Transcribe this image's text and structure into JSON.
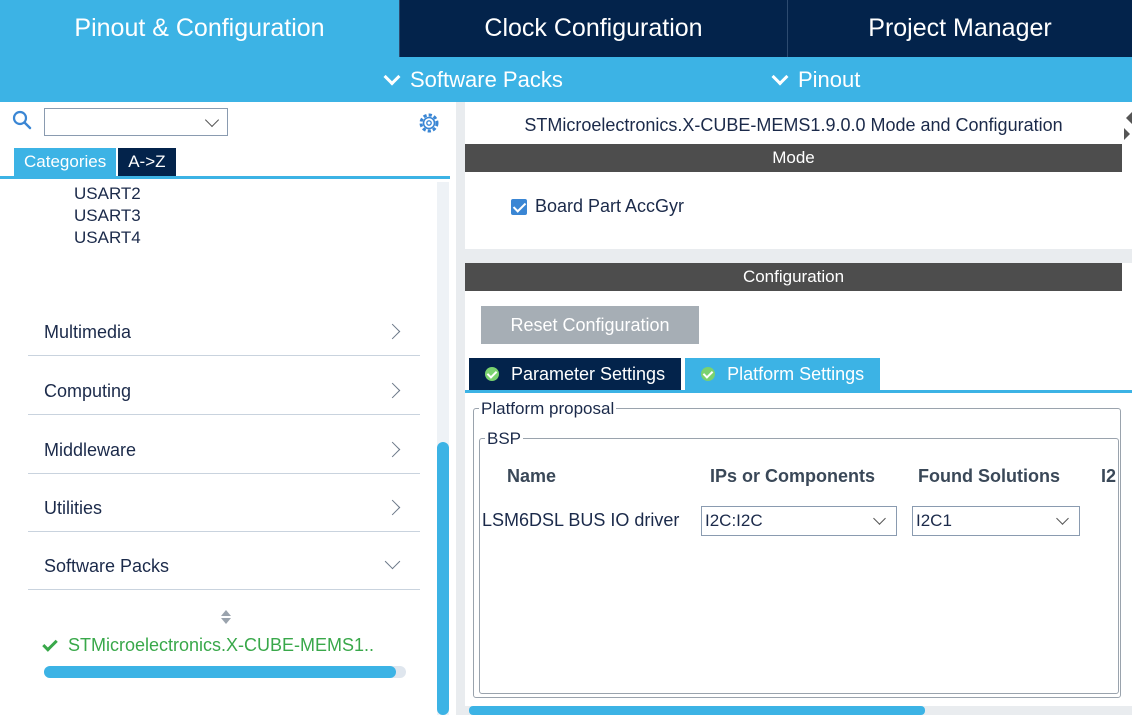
{
  "top_tabs": [
    {
      "label": "Pinout & Configuration",
      "active": true
    },
    {
      "label": "Clock Configuration",
      "active": false
    },
    {
      "label": "Project Manager",
      "active": false
    }
  ],
  "sub_bar": {
    "software_packs": "Software Packs",
    "pinout": "Pinout"
  },
  "left": {
    "search": {
      "value": "",
      "placeholder": ""
    },
    "tabs": {
      "categories": "Categories",
      "a_to_z": "A->Z"
    },
    "usart_items": [
      "USART2",
      "USART3",
      "USART4"
    ],
    "categories": [
      {
        "label": "Multimedia",
        "expanded": false
      },
      {
        "label": "Computing",
        "expanded": false
      },
      {
        "label": "Middleware",
        "expanded": false
      },
      {
        "label": "Utilities",
        "expanded": false
      },
      {
        "label": "Software Packs",
        "expanded": true
      }
    ],
    "pack_item": "STMicroelectronics.X-CUBE-MEMS1..",
    "pack_scroll_progress": 0.97
  },
  "right": {
    "title": "STMicroelectronics.X-CUBE-MEMS1.9.0.0 Mode and Configuration",
    "mode_header": "Mode",
    "board_part_checkbox": {
      "label": "Board Part AccGyr",
      "checked": true
    },
    "config_header": "Configuration",
    "reset_button": "Reset Configuration",
    "tabs": {
      "parameter": "Parameter Settings",
      "platform": "Platform Settings",
      "active": "platform"
    },
    "platform_proposal_legend": "Platform proposal",
    "bsp_legend": "BSP",
    "table": {
      "headers": [
        "Name",
        "IPs or Components",
        "Found Solutions",
        "I2"
      ],
      "rows": [
        {
          "name": "LSM6DSL BUS IO driver",
          "ip": "I2C:I2C",
          "solution": "I2C1"
        }
      ]
    }
  },
  "colors": {
    "navy": "#03234b",
    "accent_blue": "#3cb3e5",
    "section_gray": "#4d4d4d",
    "success_green": "#39a84a",
    "button_gray": "#a6aeb5"
  },
  "icons": [
    "search-icon",
    "gear-icon",
    "chevron-down-icon",
    "chevron-right-icon",
    "check-icon",
    "sort-icon",
    "check-circle-icon"
  ]
}
